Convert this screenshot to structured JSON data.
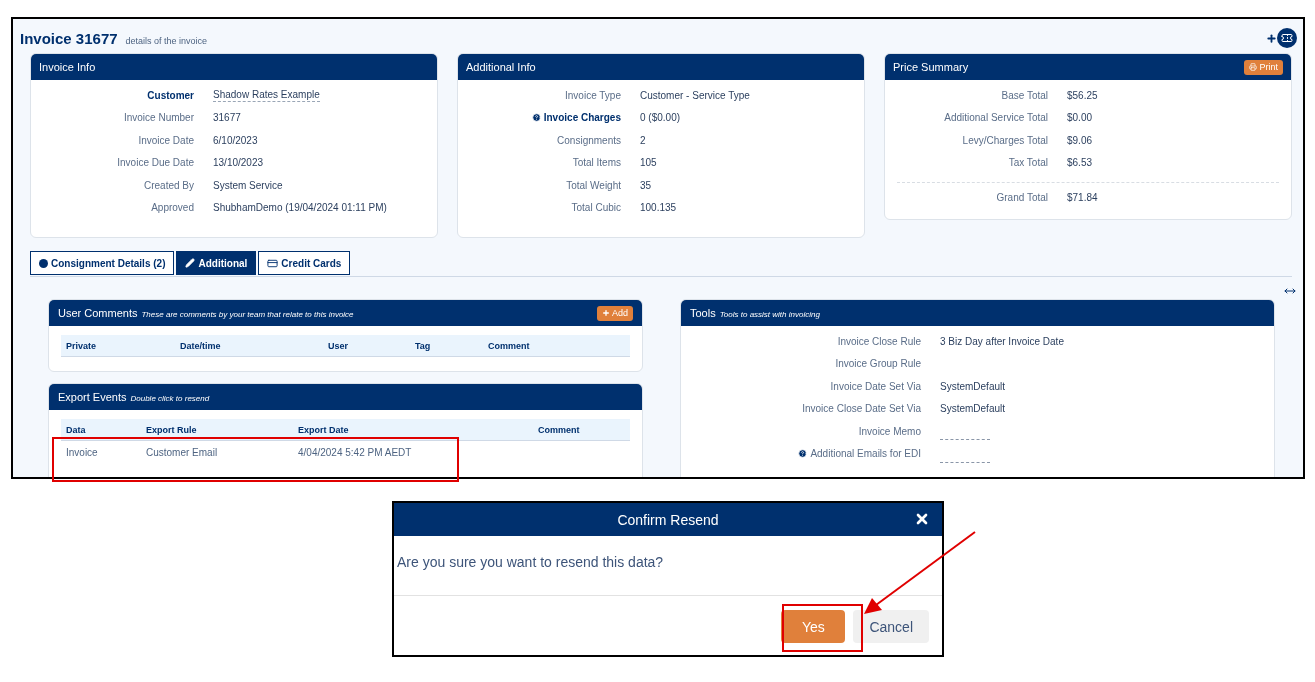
{
  "page": {
    "title": "Invoice 31677",
    "subtitle": "details of the invoice"
  },
  "cards": [
    {
      "title": "Invoice Info",
      "rows": [
        {
          "label": "Customer",
          "value": "Shadow Rates Example",
          "kind": "link"
        },
        {
          "label": "Invoice Number",
          "value": "31677",
          "kind": "text"
        },
        {
          "label": "Invoice Date",
          "value": "6/10/2023",
          "kind": "text"
        },
        {
          "label": "Invoice Due Date",
          "value": "13/10/2023",
          "kind": "text"
        },
        {
          "label": "Created By",
          "value": "System Service",
          "kind": "text"
        },
        {
          "label": "Approved",
          "value": "ShubhamDemo (19/04/2024 01:11 PM)",
          "kind": "text"
        }
      ]
    },
    {
      "title": "Additional Info",
      "rows": [
        {
          "label": "Invoice Type",
          "value": "Customer - Service Type",
          "kind": "text"
        },
        {
          "label": "Invoice Charges",
          "value": "0 ($0.00)",
          "kind": "help"
        },
        {
          "label": "Consignments",
          "value": "2",
          "kind": "text"
        },
        {
          "label": "Total Items",
          "value": "105",
          "kind": "text"
        },
        {
          "label": "Total Weight",
          "value": "35",
          "kind": "text"
        },
        {
          "label": "Total Cubic",
          "value": "100.135",
          "kind": "text"
        }
      ]
    },
    {
      "title": "Price Summary",
      "print_button": "Print",
      "rows": [
        {
          "label": "Base Total",
          "value": "$56.25",
          "kind": "text"
        },
        {
          "label": "Additional Service Total",
          "value": "$0.00",
          "kind": "text"
        },
        {
          "label": "Levy/Charges Total",
          "value": "$9.06",
          "kind": "text"
        },
        {
          "label": "Tax Total",
          "value": "$6.53",
          "kind": "text"
        },
        {
          "label": "Grand Total",
          "value": "$71.84",
          "kind": "total"
        }
      ]
    }
  ],
  "tabs": [
    {
      "label": "Consignment Details (2)",
      "selected": false
    },
    {
      "label": "Additional",
      "selected": true
    },
    {
      "label": "Credit Cards",
      "selected": false
    }
  ],
  "user_comments": {
    "title": "User Comments",
    "subtitle": "These are comments by your team that relate to this invoice",
    "add_button": "Add",
    "columns": [
      "Private",
      "Date/time",
      "User",
      "Tag",
      "Comment"
    ]
  },
  "export_events": {
    "title": "Export Events",
    "subtitle": "Double click to resend",
    "columns": [
      "Data",
      "Export Rule",
      "Export Date",
      "Comment"
    ],
    "rows": [
      {
        "cells": [
          "Invoice",
          "Customer Email",
          "4/04/2024 5:42 PM AEDT"
        ]
      }
    ]
  },
  "tools": {
    "title": "Tools",
    "subtitle": "Tools to assist with invoicing",
    "rows": [
      {
        "label": "Invoice Close Rule",
        "value": "3 Biz Day after Invoice Date",
        "kind": "text"
      },
      {
        "label": "Invoice Group Rule",
        "kind": "empty"
      },
      {
        "label": "Invoice Date Set Via",
        "value": "SystemDefault",
        "kind": "text"
      },
      {
        "label": "Invoice Close Date Set Via",
        "value": "SystemDefault",
        "kind": "text"
      },
      {
        "label": "Invoice Memo",
        "kind": "memo"
      },
      {
        "label": "Additional Emails for EDI",
        "kind": "helpmemo"
      }
    ]
  },
  "dialog": {
    "title": "Confirm Resend",
    "message": "Are you sure you want to resend this data?",
    "buttons": [
      {
        "label": "Yes",
        "kind": "primary"
      },
      {
        "label": "Cancel",
        "kind": "secondary"
      }
    ]
  }
}
